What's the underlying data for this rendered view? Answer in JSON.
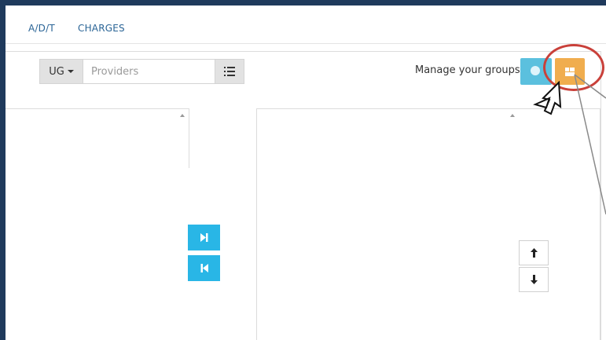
{
  "tabs": [
    {
      "label": "A/D/T"
    },
    {
      "label": "CHARGES"
    }
  ],
  "toolbar": {
    "group_button_label": "UG",
    "search_placeholder": "Providers",
    "search_value": "",
    "manage_groups_label": "Manage your groups"
  },
  "icons": {
    "list": "list-icon",
    "add": "add-circle-icon",
    "layout": "layout-icon",
    "move_right": "skip-next-icon",
    "move_left": "skip-previous-icon",
    "move_up": "arrow-up-icon",
    "move_down": "arrow-down-icon",
    "pointer": "mouse-pointer-icon"
  },
  "colors": {
    "tab_text": "#2a6496",
    "info_button": "#5bc0de",
    "warning_button": "#f0ad4e",
    "transfer_button": "#29b6e6",
    "highlight_ring": "#c9403a"
  }
}
